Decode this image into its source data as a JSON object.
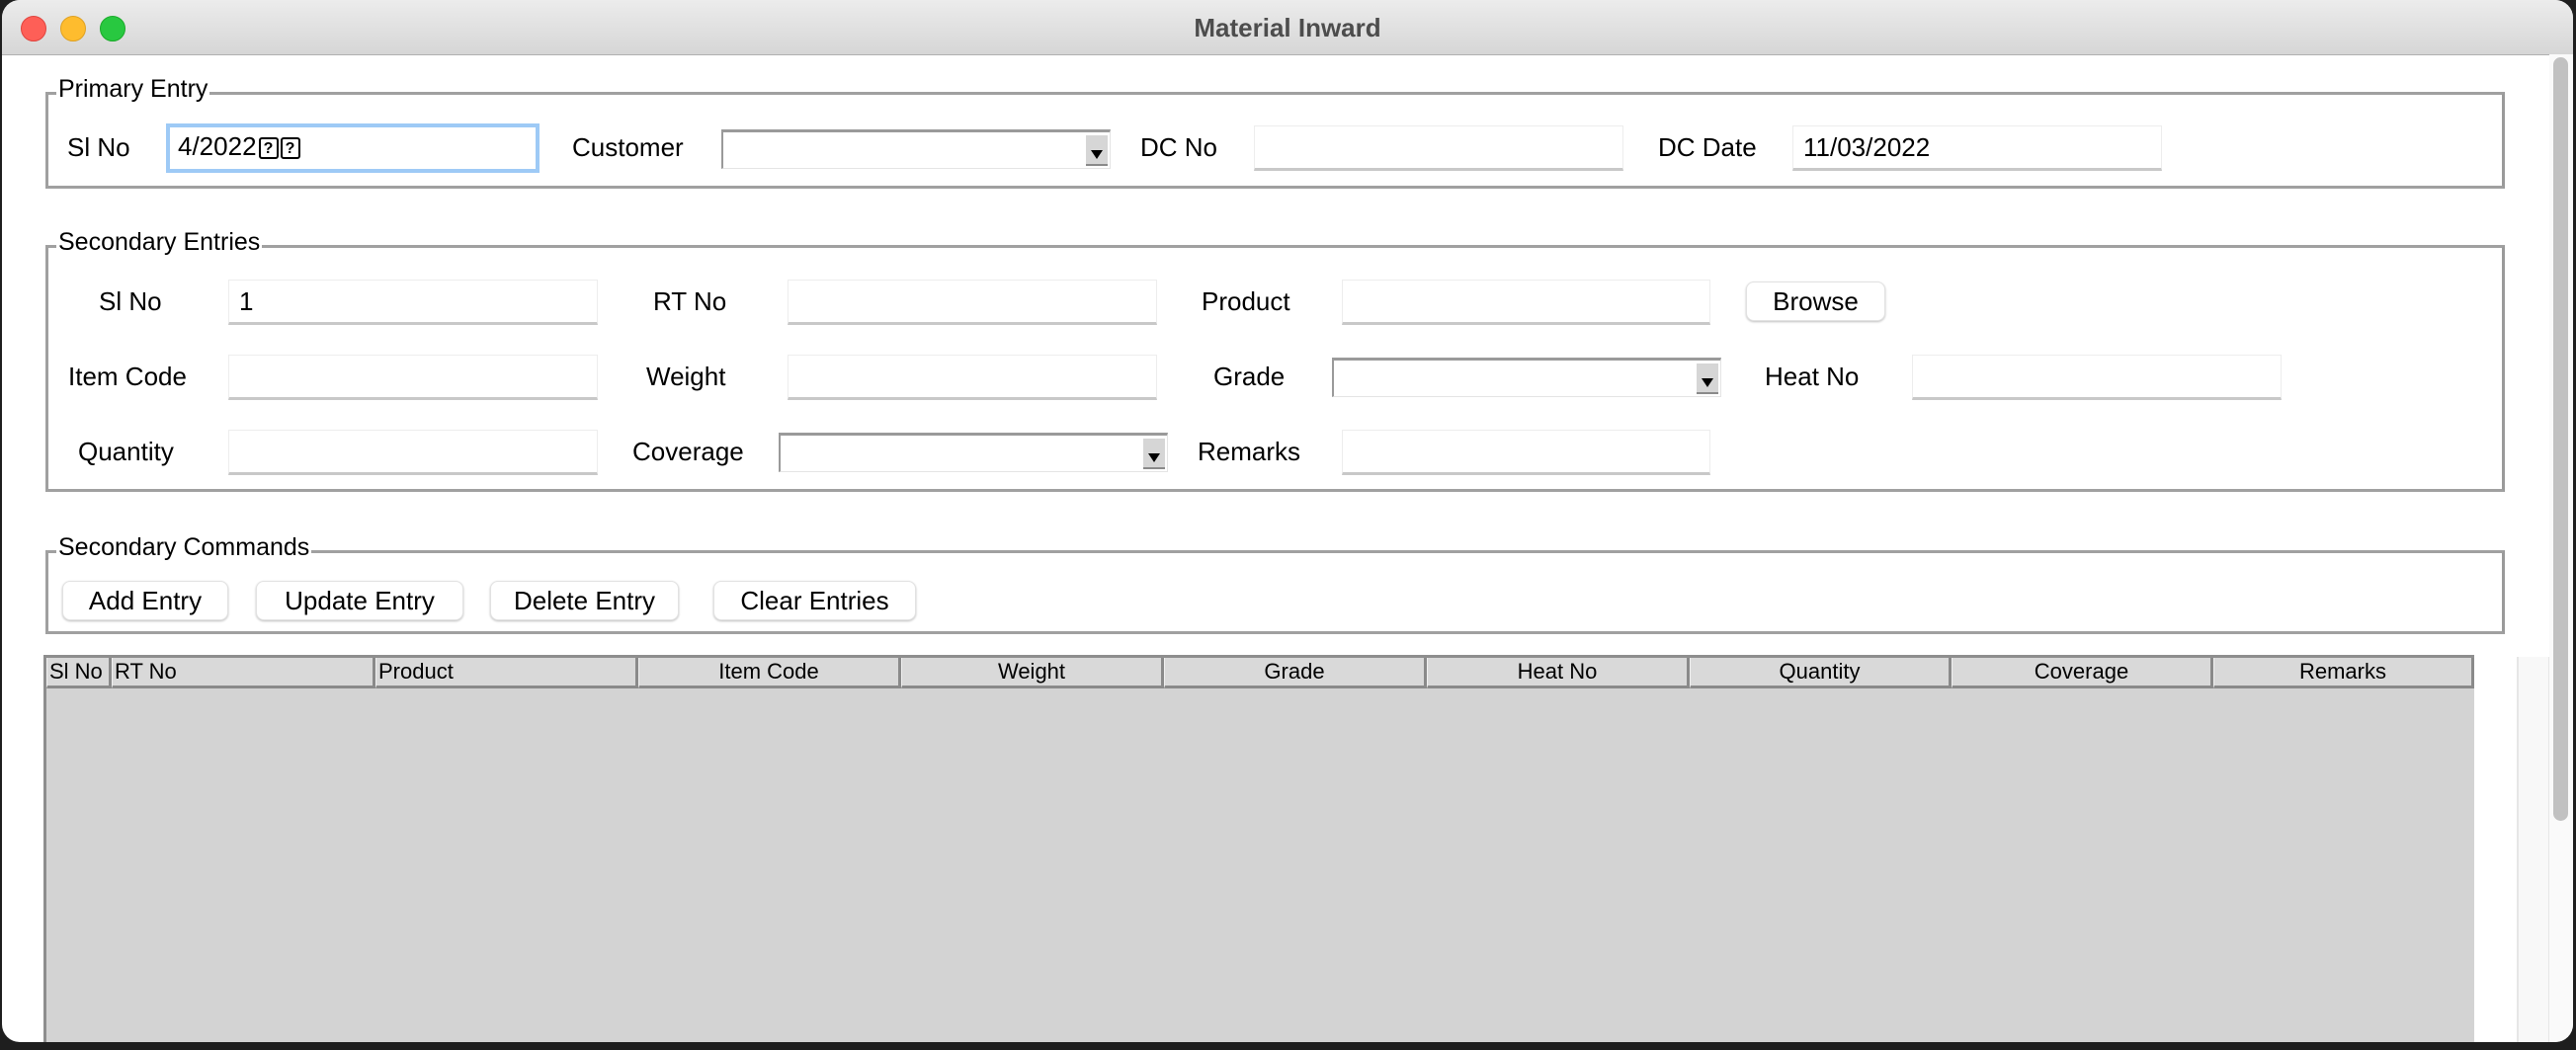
{
  "window": {
    "title": "Material Inward"
  },
  "primary": {
    "legend": "Primary Entry",
    "sl_no_label": "Sl No",
    "sl_no_value": "4/2022",
    "sl_no_glyphs": [
      "?",
      "?"
    ],
    "customer_label": "Customer",
    "customer_value": "",
    "dc_no_label": "DC No",
    "dc_no_value": "",
    "dc_date_label": "DC Date",
    "dc_date_value": "11/03/2022"
  },
  "secondary": {
    "legend": "Secondary Entries",
    "sl_no_label": "Sl No",
    "sl_no_value": "1",
    "rt_no_label": "RT No",
    "rt_no_value": "",
    "product_label": "Product",
    "product_value": "",
    "browse_label": "Browse",
    "item_code_label": "Item Code",
    "item_code_value": "",
    "weight_label": "Weight",
    "weight_value": "",
    "grade_label": "Grade",
    "grade_value": "",
    "heat_no_label": "Heat No",
    "heat_no_value": "",
    "quantity_label": "Quantity",
    "quantity_value": "",
    "coverage_label": "Coverage",
    "coverage_value": "",
    "remarks_label": "Remarks",
    "remarks_value": ""
  },
  "commands": {
    "legend": "Secondary Commands",
    "add": "Add Entry",
    "update": "Update Entry",
    "delete": "Delete Entry",
    "clear": "Clear Entries"
  },
  "table": {
    "columns": [
      "Sl No",
      "RT No",
      "Product",
      "Item Code",
      "Weight",
      "Grade",
      "Heat No",
      "Quantity",
      "Coverage",
      "Remarks"
    ],
    "rows": []
  }
}
